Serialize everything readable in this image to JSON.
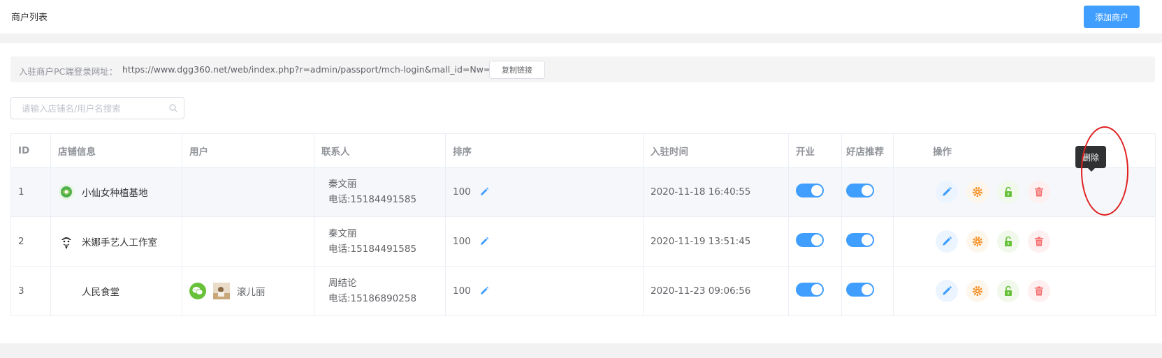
{
  "header": {
    "title": "商户列表",
    "add_button": "添加商户"
  },
  "url_bar": {
    "label": "入驻商户PC端登录网址：",
    "url": "https://www.dgg360.net/web/index.php?r=admin/passport/mch-login&mall_id=Nw==",
    "copy_button": "复制链接"
  },
  "search": {
    "placeholder": "请输入店铺名/用户名搜索",
    "value": ""
  },
  "table": {
    "headers": {
      "id": "ID",
      "store": "店铺信息",
      "user": "用户",
      "contact": "联系人",
      "sort": "排序",
      "time": "入驻时间",
      "open": "开业",
      "recommend": "好店推荐",
      "ops": "操作"
    },
    "rows": [
      {
        "id": "1",
        "store": "小仙女种植基地",
        "user": "",
        "contact_name": "秦文丽",
        "contact_phone": "电话:15184491585",
        "sort": "100",
        "time": "2020-11-18 16:40:55",
        "open": true,
        "recommend": true
      },
      {
        "id": "2",
        "store": "米娜手艺人工作室",
        "user": "",
        "contact_name": "秦文丽",
        "contact_phone": "电话:15184491585",
        "sort": "100",
        "time": "2020-11-19 13:51:45",
        "open": true,
        "recommend": true
      },
      {
        "id": "3",
        "store": "人民食堂",
        "user": "滚儿丽",
        "contact_name": "周结论",
        "contact_phone": "电话:15186890258",
        "sort": "100",
        "time": "2020-11-23 09:06:56",
        "open": true,
        "recommend": true
      }
    ]
  },
  "tooltip": {
    "text": "删除"
  },
  "colors": {
    "primary": "#409eff",
    "warning": "#f78d1f",
    "success": "#67c23a",
    "danger": "#f56c6c",
    "annotation": "#e02020"
  },
  "icons": [
    "search-icon",
    "pencil-icon",
    "gear-icon",
    "unlock-icon",
    "trash-icon",
    "wechat-icon"
  ]
}
